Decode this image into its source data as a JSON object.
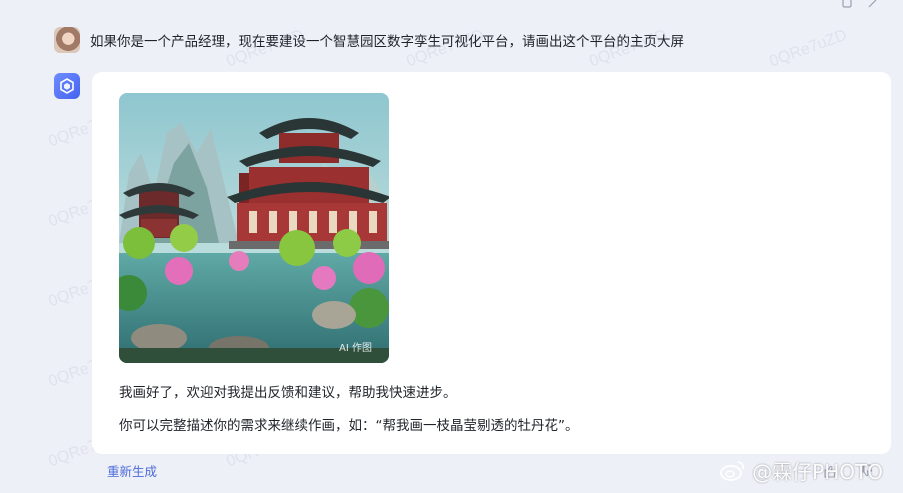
{
  "user": {
    "prompt": "如果你是一个产品经理，现在要建设一个智慧园区数字孪生可视化平台，请画出这个平台的主页大屏"
  },
  "bot": {
    "image_badge": "AI 作图",
    "reply_line1": "我画好了，欢迎对我提出反馈和建议，帮助我快速进步。",
    "reply_line2": "你可以完整描述你的需求来继续作画，如：“帮我画一枝晶莹剔透的牡丹花”。"
  },
  "actions": {
    "regenerate": "重新生成"
  },
  "overlay": {
    "watermark": "0QRe7uZD",
    "weibo_handle": "@霖仔PHOTO"
  },
  "colors": {
    "accent": "#4c6bd9",
    "page_bg": "#eef0f8",
    "card_bg": "#ffffff"
  }
}
